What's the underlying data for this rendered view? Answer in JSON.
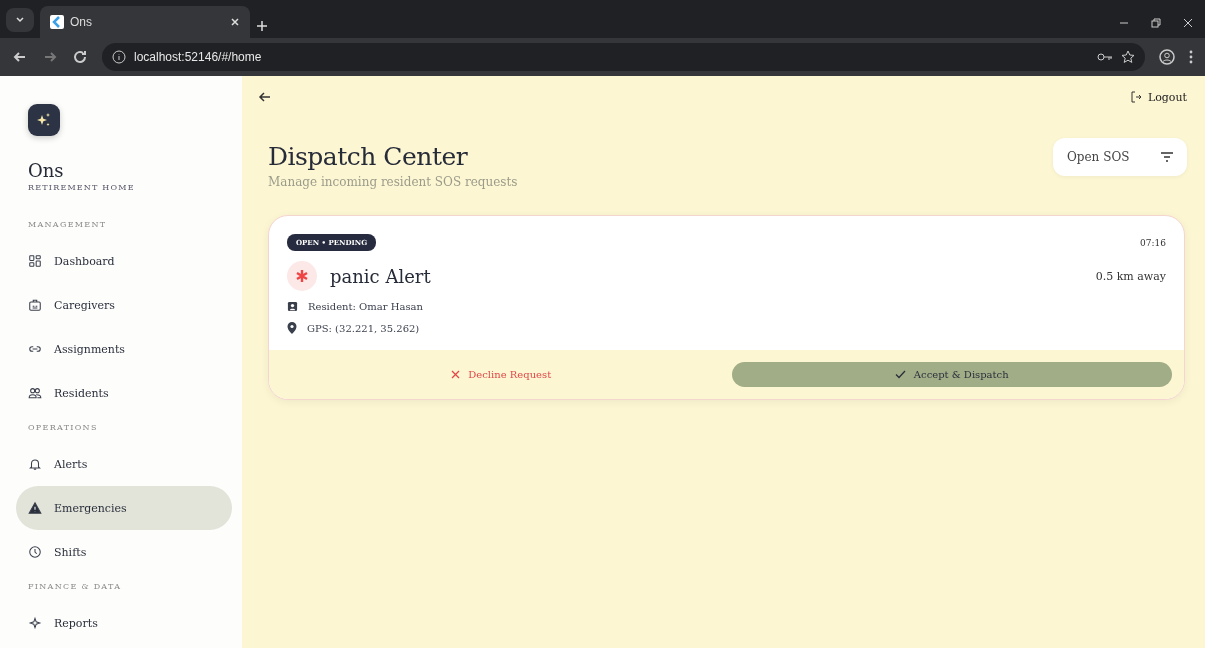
{
  "browser": {
    "tab_title": "Ons",
    "url": "localhost:52146/#/home"
  },
  "sidebar": {
    "app_name": "Ons",
    "app_subtitle": "RETIREMENT HOME",
    "sections": [
      {
        "title": "MANAGEMENT",
        "items": [
          {
            "label": "Dashboard",
            "kind": "grid",
            "selected": false
          },
          {
            "label": "Caregivers",
            "kind": "badge",
            "selected": false
          },
          {
            "label": "Assignments",
            "kind": "link",
            "selected": false
          },
          {
            "label": "Residents",
            "kind": "people",
            "selected": false
          }
        ]
      },
      {
        "title": "OPERATIONS",
        "items": [
          {
            "label": "Alerts",
            "kind": "bell",
            "selected": false
          },
          {
            "label": "Emergencies",
            "kind": "warning",
            "selected": true
          },
          {
            "label": "Shifts",
            "kind": "clock",
            "selected": false
          }
        ]
      },
      {
        "title": "FINANCE & DATA",
        "items": [
          {
            "label": "Reports",
            "kind": "sparkle",
            "selected": false
          }
        ]
      }
    ]
  },
  "header": {
    "logout": "Logout"
  },
  "page": {
    "title": "Dispatch Center",
    "subtitle": "Manage incoming resident SOS requests",
    "filter": "Open SOS"
  },
  "requests": [
    {
      "status": "OPEN • PENDING",
      "time": "07:16",
      "title": "panic Alert",
      "distance": "0.5 km away",
      "resident": "Resident: Omar Hasan",
      "gps": "GPS: (32.221, 35.262)",
      "decline": "Decline Request",
      "accept": "Accept & Dispatch"
    }
  ]
}
